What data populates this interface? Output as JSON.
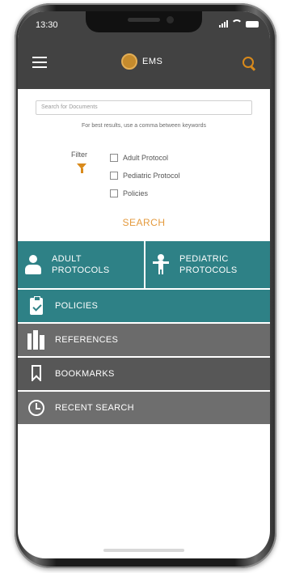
{
  "status_bar": {
    "time": "13:30"
  },
  "app_bar": {
    "brand": "EMS"
  },
  "search": {
    "placeholder": "Search for Documents",
    "hint": "For best results, use a comma between keywords",
    "button_label": "SEARCH"
  },
  "filter": {
    "label": "Filter",
    "options": [
      {
        "label": "Adult Protocol",
        "checked": false
      },
      {
        "label": "Pediatric Protocol",
        "checked": false
      },
      {
        "label": "Policies",
        "checked": false
      }
    ]
  },
  "tiles": {
    "adult": [
      "ADULT",
      "PROTOCOLS"
    ],
    "pediatric": [
      "PEDIATRIC",
      "PROTOCOLS"
    ],
    "policies": "POLICIES",
    "references": "REFERENCES",
    "bookmarks": "BOOKMARKS",
    "recent": "RECENT SEARCH"
  },
  "colors": {
    "header": "#424242",
    "accent": "#d98a1b",
    "teal": "#2e8186",
    "gray": "#6b6b6b"
  },
  "icons": [
    "menu-icon",
    "logo-icon",
    "search-icon",
    "filter-icon",
    "person-icon",
    "child-icon",
    "clipboard-icon",
    "books-icon",
    "bookmark-icon",
    "clock-icon"
  ]
}
